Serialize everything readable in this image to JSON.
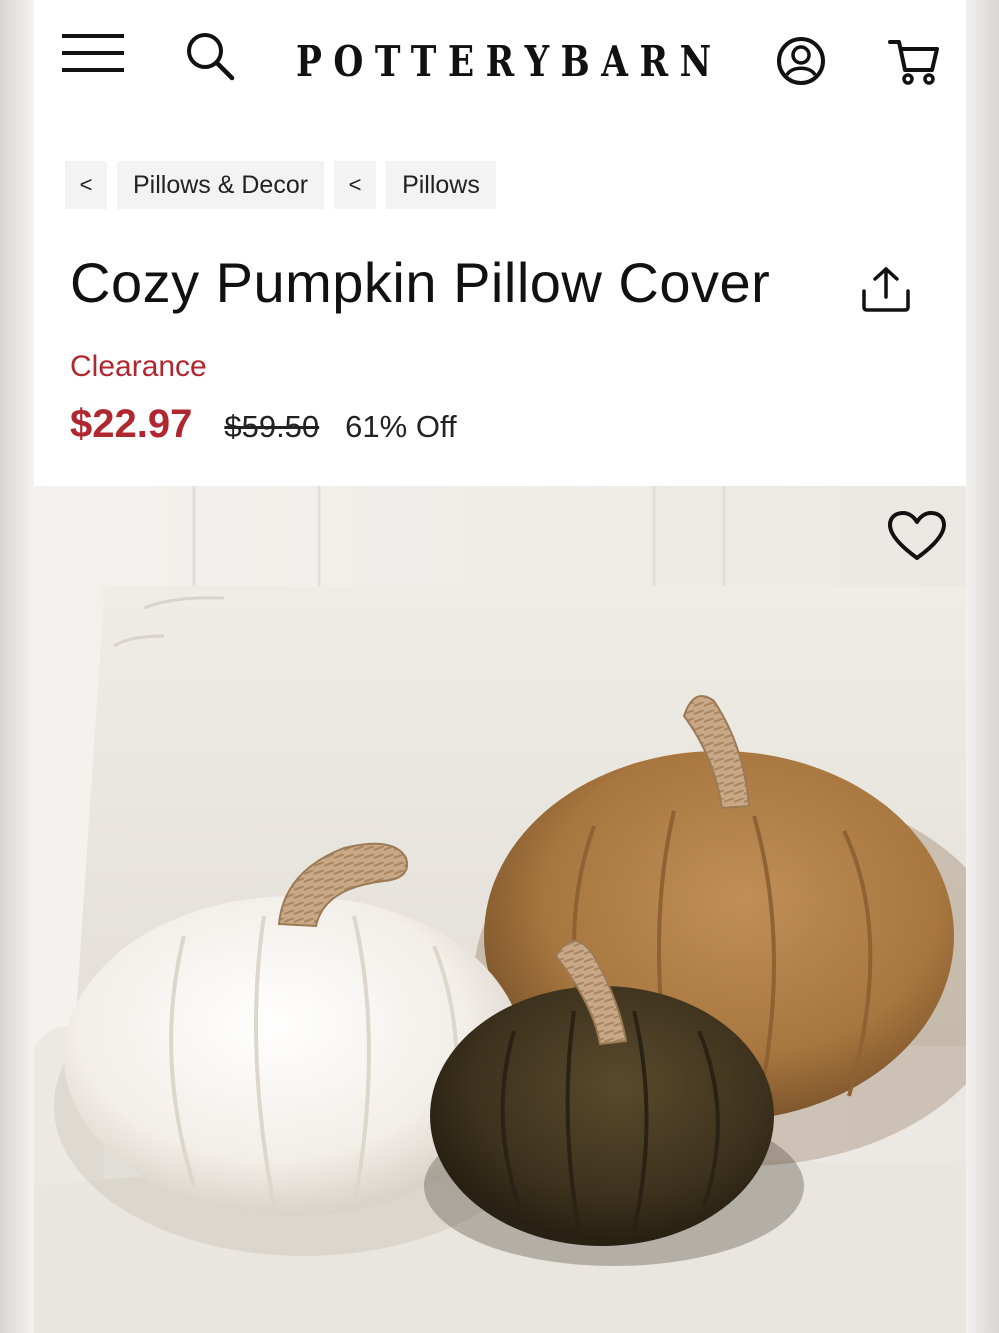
{
  "header": {
    "logo_text": "POTTERYBARN",
    "icons": [
      "hamburger-menu-icon",
      "search-icon",
      "account-icon",
      "cart-icon"
    ]
  },
  "breadcrumb": {
    "separator": "<",
    "items": [
      "Pillows & Decor",
      "Pillows"
    ]
  },
  "product": {
    "title": "Cozy Pumpkin Pillow Cover",
    "badge": "Clearance",
    "sale_price": "$22.97",
    "original_price": "$59.50",
    "discount": "61% Off",
    "image_alt": "Cozy pumpkin pillow covers in ivory, caramel, and brown on a cream sofa"
  },
  "colors": {
    "sale_red": "#b0272f",
    "text": "#111111",
    "crumb_bg": "#f3f3f3"
  }
}
